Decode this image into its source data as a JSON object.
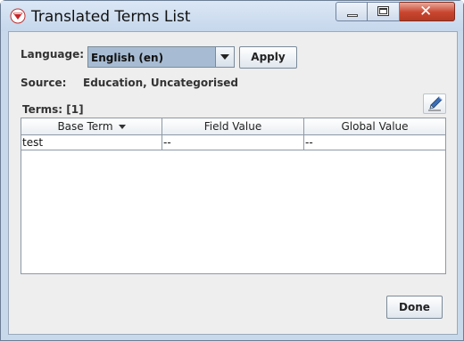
{
  "window": {
    "title": "Translated Terms List",
    "app_icon": "red-funnel-icon",
    "controls": {
      "minimize": "minimize-icon",
      "maximize": "maximize-icon",
      "close": "close-icon",
      "close_glyph": "✕"
    }
  },
  "language": {
    "label": "Language:",
    "selected": "English (en)"
  },
  "apply_label": "Apply",
  "source": {
    "label": "Source:",
    "value": "Education, Uncategorised"
  },
  "terms": {
    "label": "Terms: [1]",
    "edit_icon": "pencil-icon"
  },
  "table": {
    "columns": [
      "Base Term",
      "Field Value",
      "Global Value"
    ],
    "sorted_column": "Base Term",
    "rows": [
      [
        "test",
        "--",
        "--"
      ]
    ]
  },
  "done_label": "Done",
  "colors": {
    "select_bg": "#a7bcd3",
    "close_button": "#c8452f",
    "window_frame": "#c9d9ec"
  }
}
